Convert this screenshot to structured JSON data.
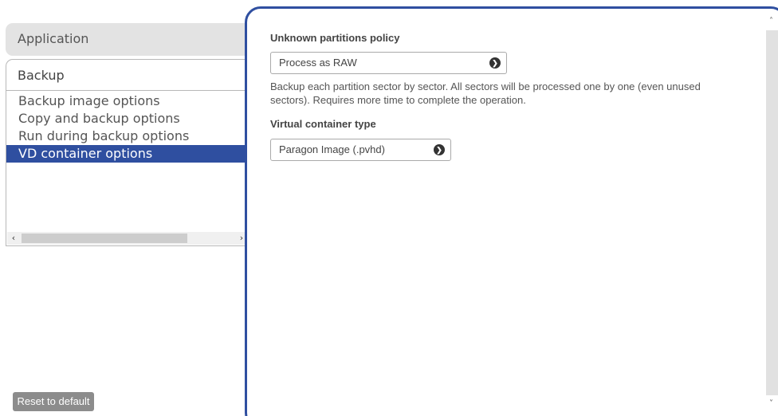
{
  "nav": {
    "application_label": "Application",
    "backup_label": "Backup",
    "items": [
      {
        "label": "Backup image options"
      },
      {
        "label": "Copy and backup options"
      },
      {
        "label": "Run during backup options"
      },
      {
        "label": "VD container options"
      }
    ],
    "selected_index": 3,
    "hscroll": {
      "left_arrow": "‹",
      "right_arrow": "›"
    }
  },
  "footer": {
    "reset_label": "Reset to default"
  },
  "settings": {
    "unknown_partitions": {
      "title": "Unknown partitions policy",
      "value": "Process as RAW",
      "description": "Backup each partition sector by sector. All sectors will be processed one by one (even unused sectors). Requires more time to complete the operation."
    },
    "container_type": {
      "title": "Virtual container type",
      "value": "Paragon Image (.pvhd)"
    }
  },
  "scrollbar": {
    "up_arrow": "˄",
    "down_arrow": "˅"
  },
  "icons": {
    "dropdown_icon": "circle-arrow-right-icon"
  },
  "colors": {
    "accent": "#2f4fa0",
    "selected_bg": "#2f4fa0",
    "reset_button_bg": "#8c8c8c"
  }
}
